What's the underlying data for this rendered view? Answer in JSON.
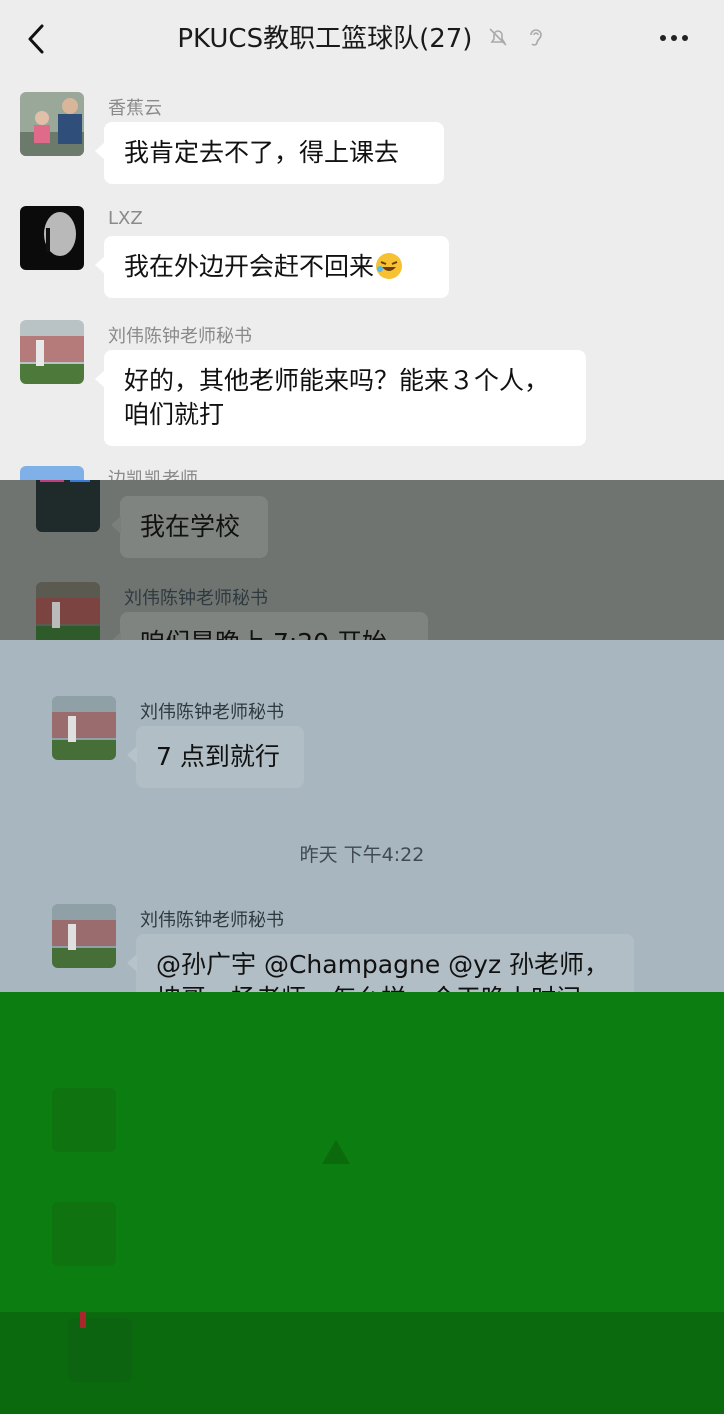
{
  "header": {
    "title": "PKUCS教职工篮球队(27)",
    "back_icon": "chevron-left-icon",
    "mute_icon": "bell-off-icon",
    "ear_icon": "ear-icon",
    "more_icon": "more-dots-icon"
  },
  "messages": [
    {
      "sender": "香蕉云",
      "text": "我肯定去不了，得上课去"
    },
    {
      "sender": "LXZ",
      "text": "我在外边开会赶不回来"
    },
    {
      "sender": "刘伟陈钟老师秘书",
      "text": "好的，其他老师能来吗？能来３个人，\n咱们就打"
    },
    {
      "sender": "边凯凯老师",
      "text": "我在学校"
    },
    {
      "sender": "刘伟陈钟老师秘书",
      "text": "咱们是晚上 7:20 开始"
    },
    {
      "sender": "刘伟陈钟老师秘书",
      "text": "7 点到就行"
    },
    {
      "sender": "刘伟陈钟老师秘书",
      "text": "@孙广宇 @Champagne @yz 孙老师，\n坤哥，杨老师，怎么样，今天晚上时间"
    }
  ],
  "timestamp": "昨天 下午4:22",
  "colors": {
    "background": "#ededed",
    "bubble": "#ffffff",
    "band_gray": "#6f7470",
    "band_blue": "#a7b6bf",
    "band_green": "#0c7d10"
  }
}
